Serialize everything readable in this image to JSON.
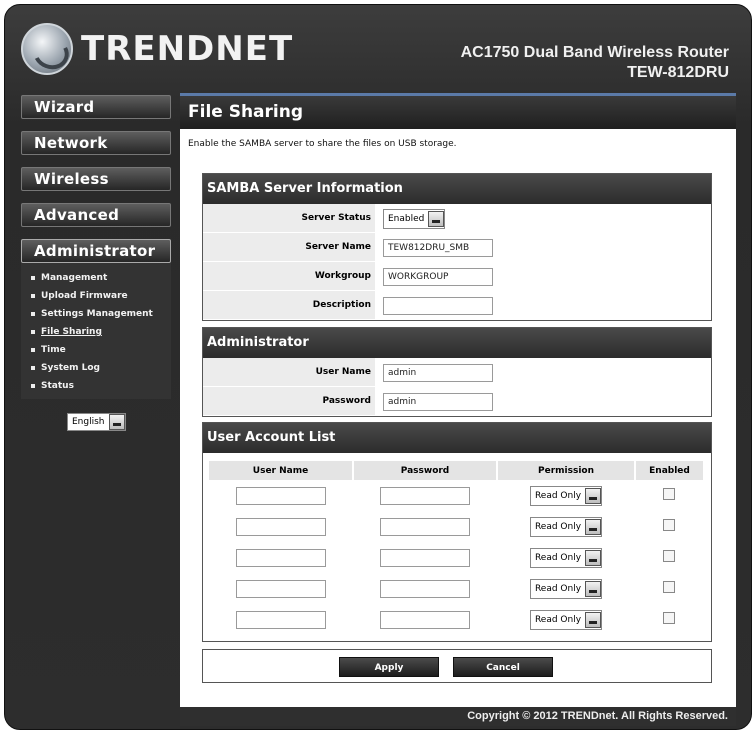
{
  "header": {
    "brand": "TRENDNET",
    "product_line1": "AC1750 Dual Band Wireless Router",
    "product_line2": "TEW-812DRU"
  },
  "nav": {
    "items": [
      {
        "label": "Wizard"
      },
      {
        "label": "Network"
      },
      {
        "label": "Wireless"
      },
      {
        "label": "Advanced"
      },
      {
        "label": "Administrator"
      }
    ],
    "submenu": [
      {
        "label": "Management"
      },
      {
        "label": "Upload Firmware"
      },
      {
        "label": "Settings Management"
      },
      {
        "label": "File Sharing"
      },
      {
        "label": "Time"
      },
      {
        "label": "System Log"
      },
      {
        "label": "Status"
      }
    ],
    "language": "English"
  },
  "page": {
    "title": "File Sharing",
    "description": "Enable the SAMBA server to share the files on USB storage."
  },
  "samba": {
    "heading": "SAMBA Server Information",
    "status_label": "Server Status",
    "status_value": "Enabled",
    "name_label": "Server Name",
    "name_value": "TEW812DRU_SMB",
    "workgroup_label": "Workgroup",
    "workgroup_value": "WORKGROUP",
    "description_label": "Description",
    "description_value": ""
  },
  "admin": {
    "heading": "Administrator",
    "user_label": "User Name",
    "user_value": "admin",
    "password_label": "Password",
    "password_value": "admin"
  },
  "accounts": {
    "heading": "User Account List",
    "col_user": "User Name",
    "col_password": "Password",
    "col_permission": "Permission",
    "col_enabled": "Enabled",
    "rows": [
      {
        "permission": "Read Only"
      },
      {
        "permission": "Read Only"
      },
      {
        "permission": "Read Only"
      },
      {
        "permission": "Read Only"
      },
      {
        "permission": "Read Only"
      }
    ]
  },
  "actions": {
    "apply": "Apply",
    "cancel": "Cancel"
  },
  "footer": "Copyright © 2012 TRENDnet. All Rights Reserved."
}
